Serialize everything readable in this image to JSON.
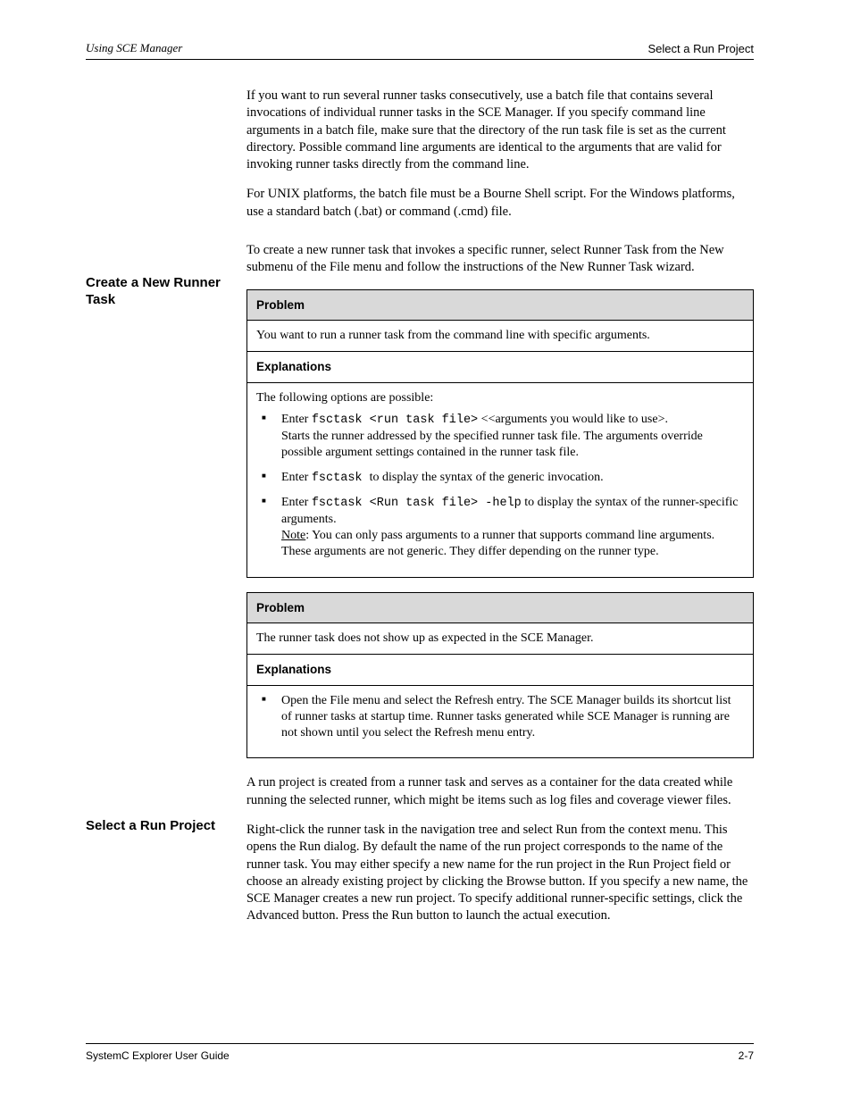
{
  "header": {
    "left": "Using SCE Manager",
    "right": "Select a Run Project"
  },
  "body": {
    "p1": "If you want to run several runner tasks consecutively, use a batch file that contains several invocations of individual runner tasks in the SCE Manager. If you specify command line arguments in a batch file, make sure that the directory of the run task file is set as the current directory. Possible command line arguments are identical to the arguments that are valid for invoking runner tasks directly from the command line.",
    "p2": "For UNIX platforms, the batch file must be a Bourne Shell script. For the Windows platforms, use a standard batch (.bat) or command (.cmd) file.",
    "side1": "Create a New Runner Task",
    "p3": "To create a new runner task that invokes a specific runner, select Runner Task from the New submenu of the File menu and follow the instructions of the New Runner Task wizard.",
    "t1": {
      "header_problem": "Problem",
      "problem_text": "You want to run a runner task from the command line with specific arguments.",
      "header_expl": "Explanations",
      "expl_intro": "The following options are possible:",
      "b1_a": "Enter ",
      "b1_b": "fsctask <run task file>",
      "b1_c": " <<arguments you would like to use>.",
      "b1_d": "Starts the runner addressed by the specified runner task file. The arguments override possible argument settings contained in the runner task file.",
      "b2_a": "Enter ",
      "b2_b": "fsctask ",
      "b2_c": "to display the syntax of the generic invocation.",
      "b3_a": "Enter ",
      "b3_b": "fsctask <Run task file> -help",
      "b3_c": " to display the syntax of the runner-specific arguments.",
      "note_a": "Note",
      "note_b": ": You can only pass arguments to a runner that supports command line arguments. These arguments are not generic. They differ depending on the runner type."
    },
    "t2": {
      "header_problem": "Problem",
      "problem_text": "The runner task does not show up as expected in the SCE Manager.",
      "header_expl": "Explanations",
      "b1": "Open the File menu and select the Refresh entry. The SCE Manager builds its shortcut list of runner tasks at startup time. Runner tasks generated while SCE Manager is running are not shown until you select the Refresh menu entry."
    },
    "side2": "Select a Run Project",
    "p4": "A run project is created from a runner task and serves as a container for the data created while running the selected runner, which might be items such as log files and coverage viewer files.",
    "p5": "Right-click the runner task in the navigation tree and select Run from the context menu. This opens the Run dialog. By default the name of the run project corresponds to the name of the runner task. You may either specify a new name for the run project in the Run Project field or choose an already existing project by clicking the Browse button. If you specify a new name, the SCE Manager creates a new run project. To specify additional runner-specific settings, click the Advanced button. Press the Run button to launch the actual execution."
  },
  "footer": {
    "left": "SystemC Explorer User Guide",
    "right": "2-7"
  }
}
